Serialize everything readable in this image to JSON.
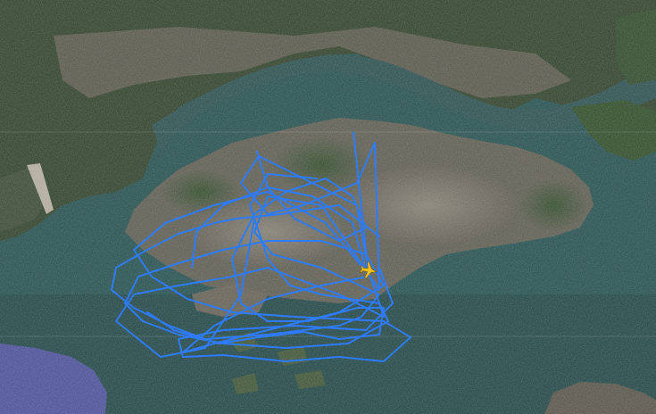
{
  "map": {
    "colors": {
      "land_dark": "#2c3d27",
      "land_mid": "#46503d",
      "urban": "#6e6b60",
      "urban_light": "#8a857a",
      "sea": "#23504f",
      "sea_deep": "#1c4242",
      "deep_blue": "#4a4f9a",
      "track": "#2f7bff",
      "aircraft": "#ffc21a"
    },
    "track_label": "flight-track",
    "aircraft_icon": "airplane-icon"
  }
}
